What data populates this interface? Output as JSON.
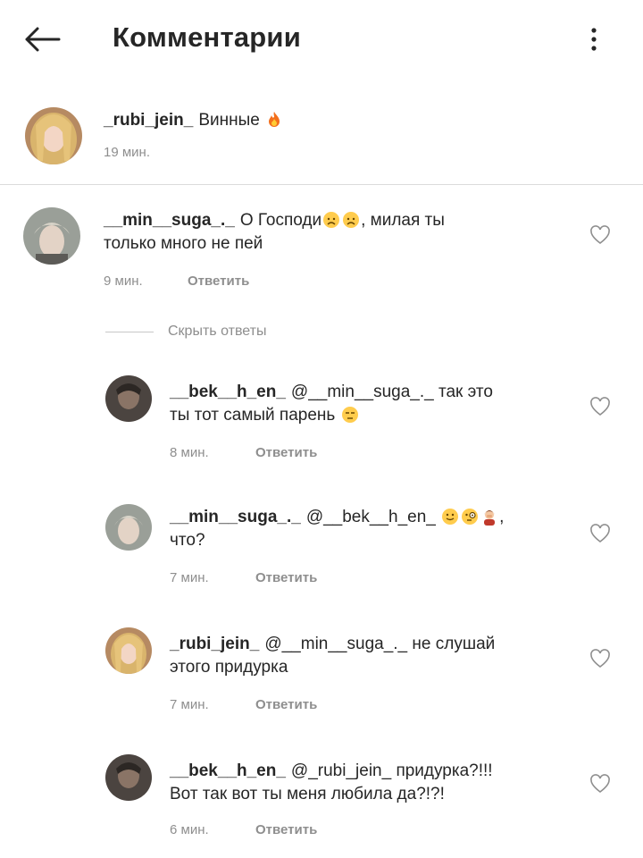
{
  "header": {
    "title": "Комментарии",
    "back_icon": "arrow-left-icon",
    "more_icon": "vertical-dots-icon"
  },
  "caption": {
    "username": "_rubi_jein_",
    "text": "Винные",
    "emoji": "fire",
    "time": "19 мин."
  },
  "comment": {
    "username": "__min__suga_._",
    "text_a": "О Господи",
    "text_b": ", милая ты",
    "text_c": "только много не пей",
    "emojis": [
      "worried-face",
      "worried-face"
    ],
    "time": "9 мин.",
    "reply_label": "Ответить"
  },
  "hide_replies_label": "Скрыть ответы",
  "replies": [
    {
      "username": "__bek__h_en_",
      "mention": "@__min__suga_._",
      "text_a": "так это",
      "text_b": "ты тот самый парень",
      "emojis": [
        "unamused-face"
      ],
      "time": "8 мин.",
      "reply_label": "Ответить"
    },
    {
      "username": "__min__suga_._",
      "mention": "@__bek__h_en_",
      "text_a": ",",
      "text_b": "что?",
      "emojis": [
        "slightly-smiling-face",
        "face-with-monocle",
        "person-facepalming"
      ],
      "time": "7 мин.",
      "reply_label": "Ответить"
    },
    {
      "username": "_rubi_jein_",
      "mention": "@__min__suga_._",
      "text_a": "не слушай",
      "text_b": "этого придурка",
      "time": "7 мин.",
      "reply_label": "Ответить"
    },
    {
      "username": "__bek__h_en_",
      "mention": "@_rubi_jein_",
      "text_a": "придурка?!!!",
      "text_b": "Вот так вот ты меня любила да?!?!",
      "time": "6 мин.",
      "reply_label": "Ответить"
    }
  ],
  "colors": {
    "text": "#262626",
    "meta": "#8e8e8e",
    "divider": "#dbdbdb"
  }
}
